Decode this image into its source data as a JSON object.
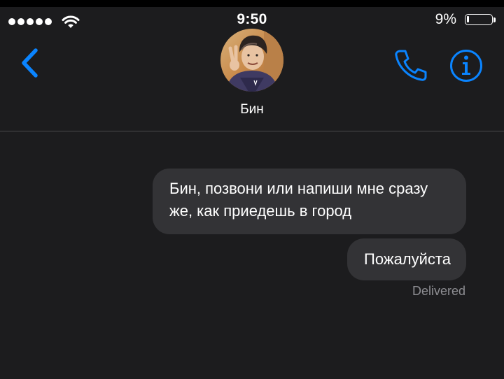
{
  "status_bar": {
    "time": "9:50",
    "battery_percent": "9%",
    "battery_level": 0.09,
    "signal_bars": 5,
    "icons": [
      "signal-dots-icon",
      "wifi-icon",
      "battery-icon"
    ]
  },
  "header": {
    "contact_name": "Бин",
    "icons": [
      "chevron-left-icon",
      "phone-icon",
      "info-icon"
    ],
    "accent_color": "#0a84ff"
  },
  "messages": [
    {
      "text": "Бин, позвони или напиши мне сразу же, как приедешь в город",
      "direction": "outgoing"
    },
    {
      "text": "Пожалуйста",
      "direction": "outgoing"
    }
  ],
  "delivery_status": "Delivered",
  "colors": {
    "background": "#1c1c1e",
    "bubble": "#333336",
    "status_text": "#8e8e93"
  }
}
